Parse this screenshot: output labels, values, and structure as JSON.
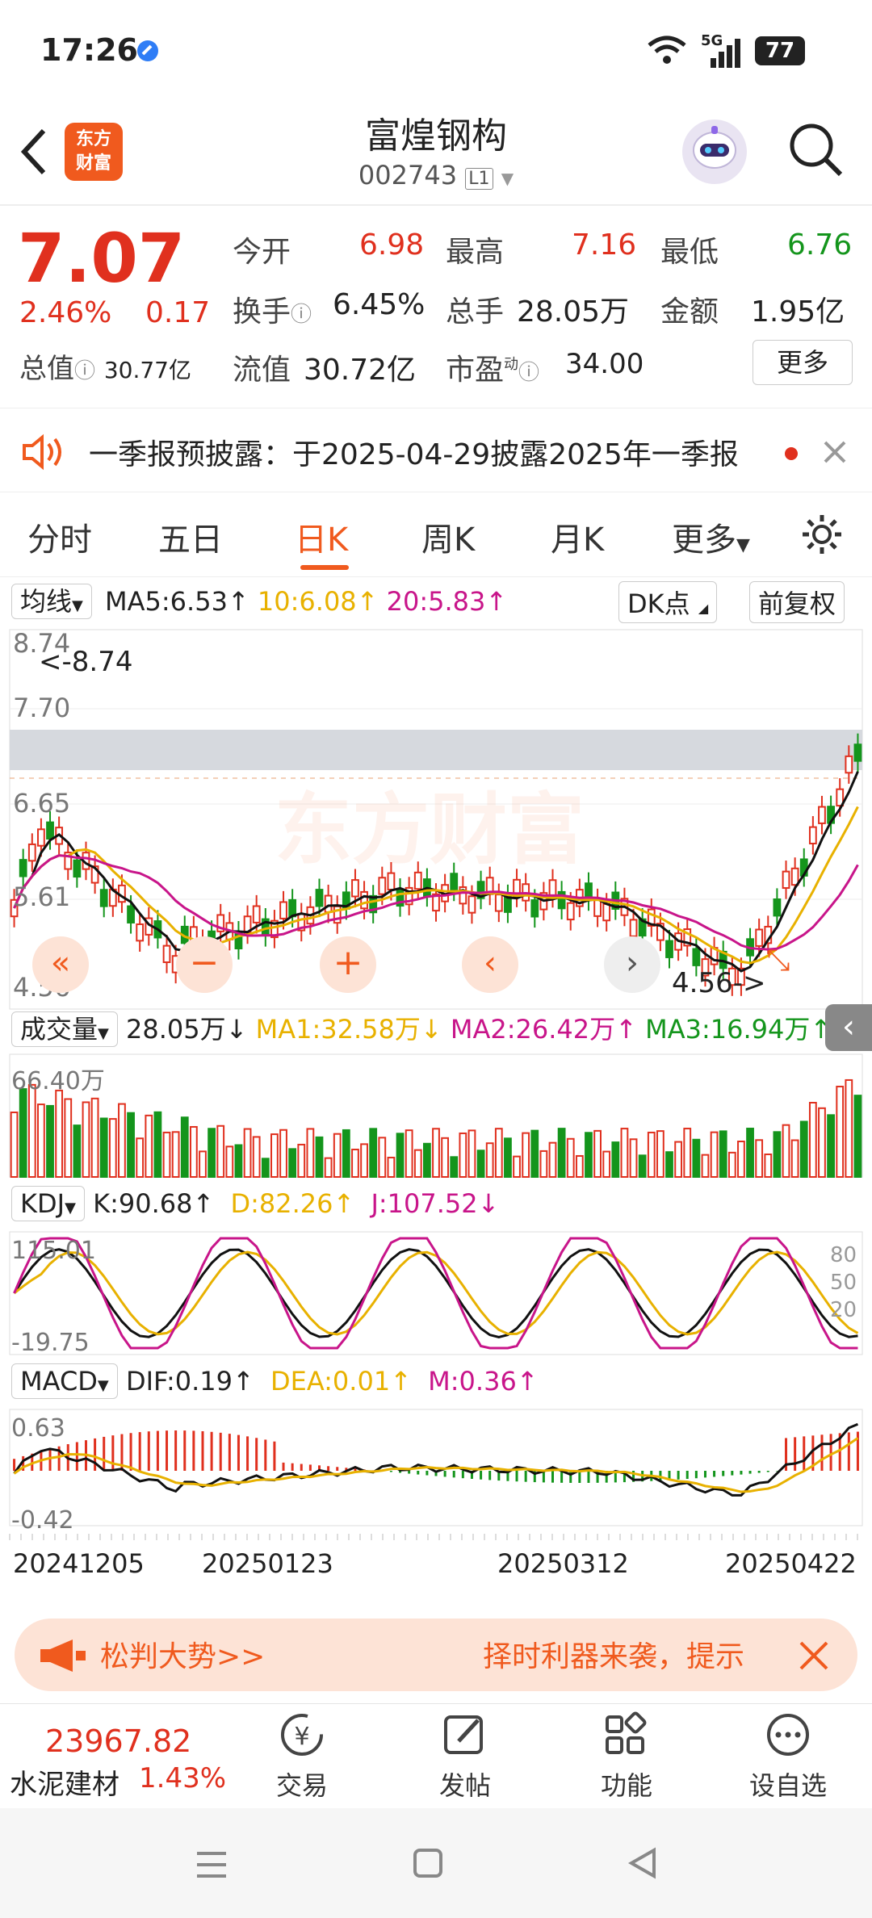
{
  "status_bar": {
    "time": "17:26",
    "network": "5G",
    "battery": "77"
  },
  "header": {
    "logo_line1": "东方",
    "logo_line2": "财富",
    "stock_name": "富煌钢构",
    "stock_code": "002743",
    "level_badge": "L1"
  },
  "quote": {
    "price": "7.07",
    "change_pct": "2.46%",
    "change_amt": "0.17",
    "open_label": "今开",
    "open": "6.98",
    "high_label": "最高",
    "high": "7.16",
    "low_label": "最低",
    "low": "6.76",
    "turnover_label": "换手",
    "turnover": "6.45%",
    "volume_label": "总手",
    "volume": "28.05万",
    "amount_label": "金额",
    "amount": "1.95亿",
    "mktcap_label": "总值",
    "mktcap": "30.77亿",
    "float_label": "流值",
    "float": "30.72亿",
    "pe_label": "市盈",
    "pe_super": "动",
    "pe": "34.00",
    "more_button": "更多"
  },
  "notice": {
    "text": "一季报预披露：于2025-04-29披露2025年一季报"
  },
  "tabs": {
    "items": [
      "分时",
      "五日",
      "日K",
      "周K",
      "月K",
      "更多"
    ],
    "active": "日K"
  },
  "ma_row": {
    "select": "均线",
    "ma5": "MA5:6.53↑",
    "ma10": "10:6.08↑",
    "ma20": "20:5.83↑",
    "dk": "DK点",
    "adjust": "前复权"
  },
  "kline": {
    "y_labels": [
      "8.74",
      "7.70",
      "6.65",
      "5.61",
      "4.56"
    ],
    "high_marker": "<-8.74",
    "low_marker": "4.56->",
    "watermark": "东方财富"
  },
  "volume_row": {
    "select": "成交量",
    "vol": "28.05万↓",
    "ma1": "MA1:32.58万↓",
    "ma2": "MA2:26.42万↑",
    "ma3": "MA3:16.94万↑",
    "y_max": "66.40万"
  },
  "kdj_row": {
    "select": "KDJ",
    "k": "K:90.68↑",
    "d": "D:82.26↑",
    "j": "J:107.52↓",
    "y_max": "115.01",
    "y_min": "-19.75",
    "levels": [
      "80",
      "50",
      "20"
    ]
  },
  "macd_row": {
    "select": "MACD",
    "dif": "DIF:0.19↑",
    "dea": "DEA:0.01↑",
    "m": "M:0.36↑",
    "y_max": "0.63",
    "y_min": "-0.42"
  },
  "dates": [
    "20241205",
    "20250123",
    "20250312",
    "20250422"
  ],
  "banner": {
    "left": "松判大势>>",
    "right": "择时利器来袭，提示"
  },
  "bottom": {
    "index_value": "23967.82",
    "index_name": "水泥建材",
    "index_change": "1.43%",
    "nav": [
      "交易",
      "发帖",
      "功能",
      "设自选"
    ]
  },
  "colors": {
    "up": "#e0301e",
    "down": "#14951c",
    "ma5": "#111111",
    "ma10": "#e8b100",
    "ma20": "#c8158a",
    "accent": "#f05a1e"
  }
}
